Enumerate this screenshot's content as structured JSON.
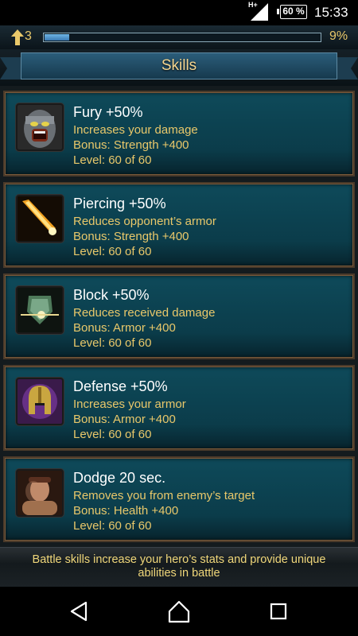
{
  "status_bar": {
    "network": "H+",
    "battery": "60 %",
    "time": "15:33"
  },
  "header": {
    "level": "3",
    "xp_progress": 0.09,
    "xp_percent": "9%"
  },
  "page": {
    "title": "Skills"
  },
  "skills": [
    {
      "name": "Fury +50%",
      "description": "Increases your damage",
      "bonus": "Bonus: Strength +400",
      "level": "Level: 60 of 60",
      "icon": "fury-helmet-icon"
    },
    {
      "name": "Piercing +50%",
      "description": "Reduces opponent’s armor",
      "bonus": "Bonus: Strength +400",
      "level": "Level: 60 of 60",
      "icon": "piercing-arrow-icon"
    },
    {
      "name": "Block +50%",
      "description": "Reduces received damage",
      "bonus": "Bonus: Armor +400",
      "level": "Level: 60 of 60",
      "icon": "block-shield-icon"
    },
    {
      "name": "Defense +50%",
      "description": "Increases your armor",
      "bonus": "Bonus: Armor +400",
      "level": "Level: 60 of 60",
      "icon": "defense-helmet-icon"
    },
    {
      "name": "Dodge 20 sec.",
      "description": "Removes you from enemy’s target",
      "bonus": "Bonus: Health +400",
      "level": "Level: 60 of 60",
      "icon": "dodge-warrior-icon"
    }
  ],
  "footer": {
    "text": "Battle skills increase your hero’s stats and provide unique abilities in battle"
  },
  "colors": {
    "accent_gold": "#e9c86a",
    "card_teal": "#0b3c4a",
    "xp_blue": "#4a90c8"
  }
}
